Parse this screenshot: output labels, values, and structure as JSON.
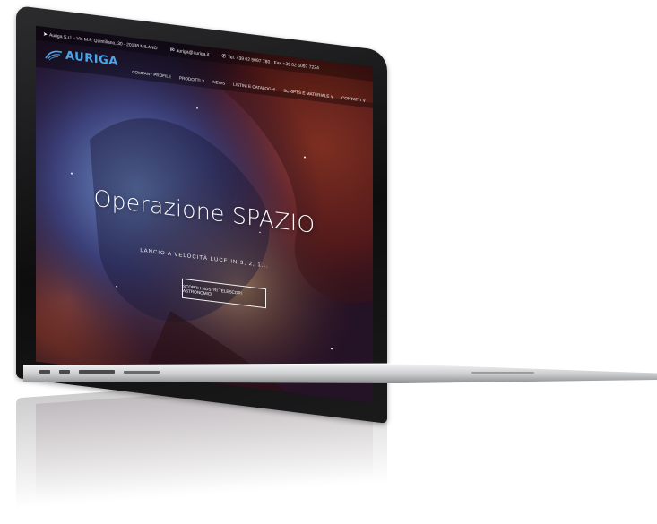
{
  "website": {
    "infobar": {
      "address": "Auriga S.r.l. - Via M.F. Quintiliano, 30 - 20138 MILANO",
      "email": "auriga@auriga.it",
      "phone": "Tel. +39 02 5097 780 - Fax +39 02 5097 7224"
    },
    "logo": {
      "text": "AURIGA",
      "color": "#4aa6e8"
    },
    "nav": [
      "COMPANY PROFILE",
      "PRODOTTI ∨",
      "NEWS",
      "LISTINI E CATALOGHI",
      "SCRIPTS E MATERIALE ∨",
      "CONTATTI ∨"
    ],
    "hero": {
      "title": "Operazione SPAZIO",
      "subtitle": "LANCIO A VELOCITÀ LUCE IN 3, 2, 1...",
      "button": "SCOPRI I NOSTRI TELESCOPI ASTRONOMICI"
    }
  }
}
